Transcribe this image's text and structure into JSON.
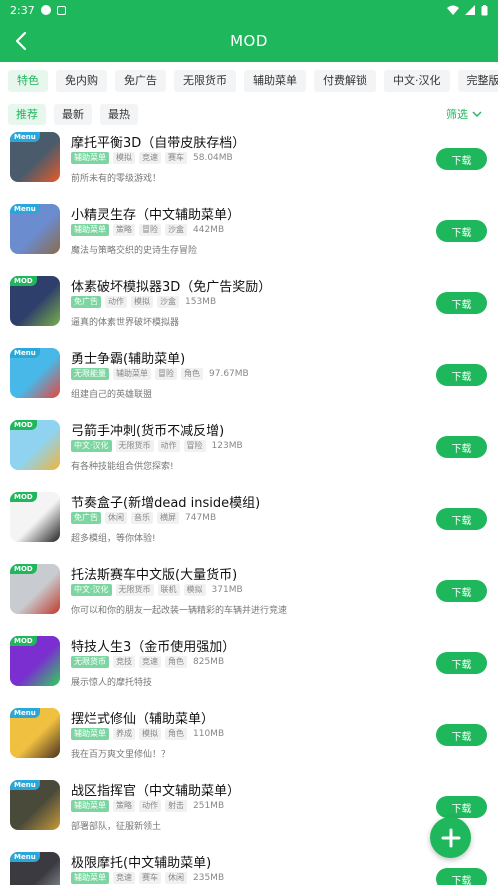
{
  "status_bar": {
    "time": "2:37"
  },
  "app_bar": {
    "title": "MOD"
  },
  "tabs": [
    {
      "label": "特色"
    },
    {
      "label": "免内购"
    },
    {
      "label": "免广告"
    },
    {
      "label": "无限货币"
    },
    {
      "label": "辅助菜单"
    },
    {
      "label": "付费解锁"
    },
    {
      "label": "中文·汉化"
    },
    {
      "label": "完整版"
    }
  ],
  "sort_tabs": [
    {
      "label": "推荐"
    },
    {
      "label": "最新"
    },
    {
      "label": "最热"
    }
  ],
  "filter_label": "筛选",
  "download_label": "下载",
  "apps": [
    {
      "badge": "Menu",
      "name": "摩托平衡3D（自带皮肤存档）",
      "tags": [
        "辅助菜单",
        "模拟",
        "竞速",
        "赛车"
      ],
      "size": "58.04MB",
      "desc": "前所未有的零级游戏！",
      "colors": [
        "#4a5b6b",
        "#e85b2a"
      ]
    },
    {
      "badge": "Menu",
      "name": "小精灵生存（中文辅助菜单）",
      "tags": [
        "辅助菜单",
        "策略",
        "冒险",
        "沙盒"
      ],
      "size": "442MB",
      "desc": "魔法与策略交织的史诗生存冒险",
      "colors": [
        "#6b8ccf",
        "#8b6b4a"
      ]
    },
    {
      "badge": "MOD",
      "name": "体素破坏模拟器3D（免广告奖励）",
      "tags": [
        "免广告",
        "动作",
        "模拟",
        "沙盒"
      ],
      "size": "153MB",
      "desc": "逼真的体素世界破坏模拟器",
      "colors": [
        "#2f3f6b",
        "#7ab04a"
      ]
    },
    {
      "badge": "Menu",
      "name": "勇士争霸(辅助菜单)",
      "tags": [
        "无限能量",
        "辅助菜单",
        "冒险",
        "角色"
      ],
      "size": "97.67MB",
      "desc": "组建自己的英雄联盟",
      "colors": [
        "#48b8e8",
        "#e8453c"
      ]
    },
    {
      "badge": "MOD",
      "name": "弓箭手冲刺(货币不减反增)",
      "tags": [
        "中文·汉化",
        "无限货币",
        "动作",
        "冒险"
      ],
      "size": "123MB",
      "desc": "有各种技能组合供您探索!",
      "colors": [
        "#8fd3f0",
        "#f0b43c"
      ]
    },
    {
      "badge": "MOD",
      "name": "节奏盒子(新增dead inside模组)",
      "tags": [
        "免广告",
        "休闲",
        "音乐",
        "横屏"
      ],
      "size": "747MB",
      "desc": "超多模组，等你体验!",
      "colors": [
        "#f4f4f4",
        "#222222"
      ]
    },
    {
      "badge": "MOD",
      "name": "托法斯赛车中文版(大量货币)",
      "tags": [
        "中文·汉化",
        "无限货币",
        "联机",
        "模拟"
      ],
      "size": "371MB",
      "desc": "你可以和你的朋友一起改装一辆精彩的车辆并进行竞速",
      "colors": [
        "#c8ccd0",
        "#c0392b"
      ]
    },
    {
      "badge": "MOD",
      "name": "特技人生3（金币使用强加）",
      "tags": [
        "无限货币",
        "竞技",
        "竞速",
        "角色"
      ],
      "size": "825MB",
      "desc": "展示惊人的摩托特技",
      "colors": [
        "#7b2fd0",
        "#2ed15a"
      ]
    },
    {
      "badge": "Menu",
      "name": "摆烂式修仙（辅助菜单）",
      "tags": [
        "辅助菜单",
        "养成",
        "模拟",
        "角色"
      ],
      "size": "110MB",
      "desc": "我在百万爽文里修仙！？",
      "colors": [
        "#f0c040",
        "#4a3020"
      ]
    },
    {
      "badge": "Menu",
      "name": "战区指挥官（中文辅助菜单）",
      "tags": [
        "辅助菜单",
        "策略",
        "动作",
        "射击"
      ],
      "size": "251MB",
      "desc": "部署部队，征服新领土",
      "colors": [
        "#4a4a3a",
        "#c89a3a"
      ]
    },
    {
      "badge": "Menu",
      "name": "极限摩托(中文辅助菜单)",
      "tags": [
        "辅助菜单",
        "竞速",
        "赛车",
        "休闲"
      ],
      "size": "235MB",
      "desc": "",
      "colors": [
        "#3a3a40",
        "#9aa0a8"
      ]
    }
  ]
}
